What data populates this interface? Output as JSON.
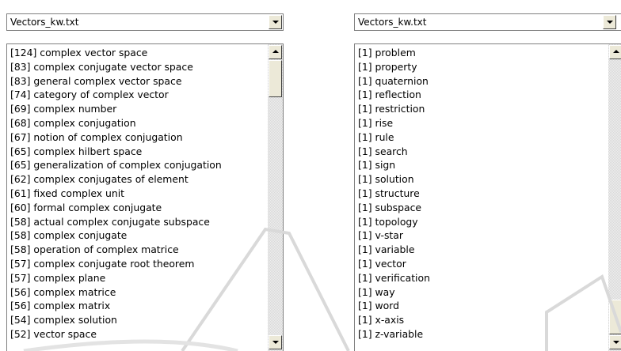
{
  "left_panel": {
    "combo_value": "Vectors_kw.txt",
    "items": [
      "[124] complex vector space",
      "[83] complex conjugate vector space",
      "[83] general complex vector space",
      "[74] category of complex vector",
      "[69] complex number",
      "[68] complex conjugation",
      "[67] notion of complex conjugation",
      "[65] complex hilbert space",
      "[65] generalization of complex conjugation",
      "[62] complex conjugates of element",
      "[61] fixed complex unit",
      "[60] formal complex conjugate",
      "[58] actual complex conjugate subspace",
      "[58] complex conjugate",
      "[58] operation of complex matrice",
      "[57] complex conjugate root theorem",
      "[57] complex plane",
      "[56] complex matrice",
      "[56] complex matrix",
      "[54] complex solution",
      "[52] vector space"
    ]
  },
  "right_panel": {
    "combo_value": "Vectors_kw.txt",
    "items": [
      "[1] problem",
      "[1] property",
      "[1] quaternion",
      "[1] reflection",
      "[1] restriction",
      "[1] rise",
      "[1] rule",
      "[1] search",
      "[1] sign",
      "[1] solution",
      "[1] structure",
      "[1] subspace",
      "[1] topology",
      "[1] v-star",
      "[1] variable",
      "[1] vector",
      "[1] verification",
      "[1] way",
      "[1] word",
      "[1] x-axis",
      "[1] z-variable"
    ]
  },
  "icons": {
    "combo_arrow": "chevron-down-icon",
    "scroll_up": "arrow-up-icon",
    "scroll_down": "arrow-down-icon"
  },
  "colors": {
    "button_face": "#ece9d8",
    "border": "#7f7f7f",
    "watermark": "#d9d9d9"
  }
}
